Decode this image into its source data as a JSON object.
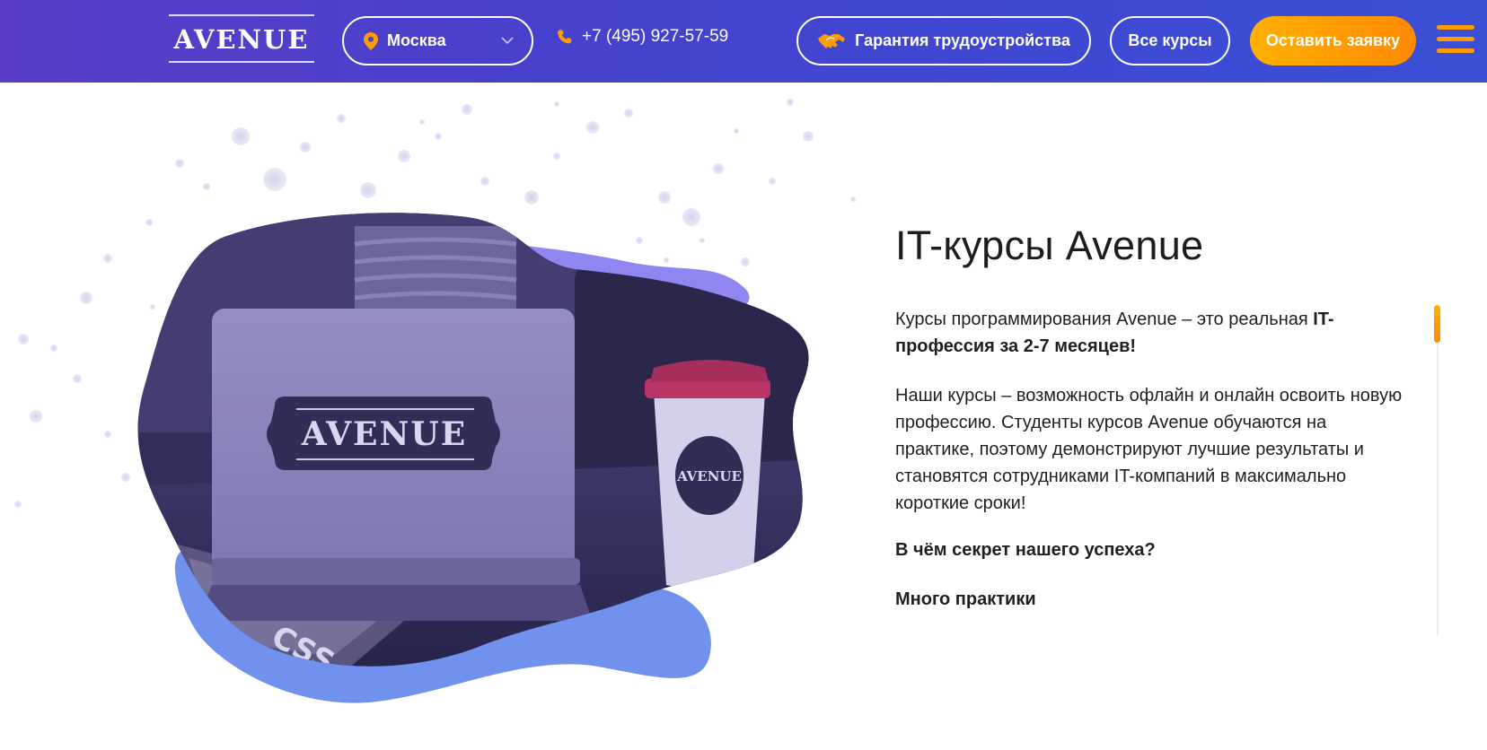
{
  "header": {
    "logo_text": "AVENUE",
    "city": "Москва",
    "phone": "+7 (495) 927-57-59",
    "guarantee_label": "Гарантия трудоустройства",
    "courses_label": "Все курсы",
    "apply_label": "Оставить заявку",
    "icons": [
      "map-pin-icon",
      "chevron-down-icon",
      "phone-icon",
      "handshake-icon",
      "hamburger-menu-icon"
    ]
  },
  "hero": {
    "title": "IT-курсы Avenue",
    "paragraph1_prefix": "Курсы программирования Avenue – это реальная ",
    "paragraph1_bold": "IT-профессия за 2-7 месяцев!",
    "paragraph2": "Наши курсы – возможность офлайн и онлайн освоить новую профессию. Студенты курсов Avenue обучаются на практике, поэтому демонстрируют лучшие результаты и становятся сотрудниками IT-компаний в максимально короткие сроки!",
    "question": "В чём секрет нашего успеха?",
    "subheading": "Много практики",
    "image": {
      "laptop_sticker_text": "AVENUE",
      "cup_logo_text": "AVENUE"
    }
  },
  "colors": {
    "header_gradient_start": "#5a3cc6",
    "header_gradient_end": "#3a4fd6",
    "accent_orange": "#ff9c00",
    "blob_violet": "#8f86f2",
    "blob_blue": "#7191ee",
    "photo_tint": "#3a3560",
    "cup_lid": "#c8305a"
  }
}
